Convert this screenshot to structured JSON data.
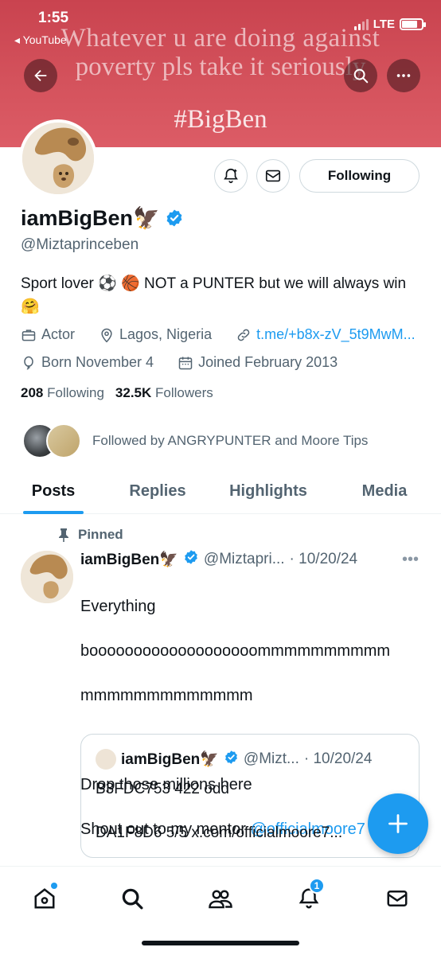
{
  "status_bar": {
    "time": "1:55",
    "back_app": "◂ YouTube",
    "network": "LTE"
  },
  "banner": {
    "line1": "Whatever u are doing against",
    "line2": "poverty pls take it seriously",
    "line3": "#BigBen"
  },
  "profile": {
    "display_name": "iamBigBen🦅",
    "handle": "@Miztaprinceben",
    "bio": "Sport lover ⚽️ 🏀 NOT a PUNTER but we will always win 🤗",
    "category": "Actor",
    "location": "Lagos, Nigeria",
    "link": "t.me/+b8x-zV_5t9MwM...",
    "birthday": "Born November 4",
    "joined": "Joined February 2013",
    "following_count": "208",
    "following_label": "Following",
    "followers_count": "32.5K",
    "followers_label": "Followers",
    "followed_by": "Followed by ANGRYPUNTER and Moore Tips",
    "following_button": "Following"
  },
  "tabs": [
    {
      "label": "Posts",
      "active": true
    },
    {
      "label": "Replies",
      "active": false
    },
    {
      "label": "Highlights",
      "active": false
    },
    {
      "label": "Media",
      "active": false
    }
  ],
  "post": {
    "pinned_label": "Pinned",
    "name": "iamBigBen🦅",
    "handle": "@Miztapri...",
    "date": "· 10/20/24",
    "line1": "Everything",
    "line2": "booooooooooooooooooommmmmmmmmm",
    "line3": "mmmmmmmmmmmmm",
    "line4": "Drop those millions here",
    "line5": "Shout out to my mentor",
    "mention": "@officialmoore7",
    "emoji": "💚 ❤️",
    "quote": {
      "name": "iamBigBen🦅",
      "handle": "@Mizt...",
      "date": "· 10/20/24",
      "line1": "B3FDC753 422 odd",
      "line2": "DA1F8D6 5/5 x.com/officialmoore7..."
    }
  },
  "nav": {
    "notifications_badge": "1"
  },
  "colors": {
    "accent": "#1d9bf0",
    "banner": "#d4525c",
    "text": "#0f1419",
    "muted": "#536471"
  }
}
